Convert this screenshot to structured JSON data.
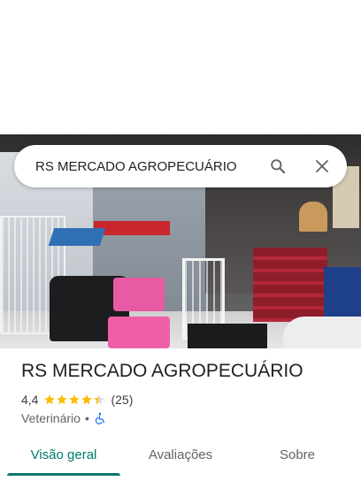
{
  "search": {
    "query": "RS MERCADO AGROPECUÁRIO",
    "search_icon": "search-icon",
    "close_icon": "close-icon"
  },
  "photo": {
    "description_icon": "store-photo"
  },
  "place": {
    "title": "RS MERCADO AGROPECUÁRIO",
    "rating": "4,4",
    "stars": 4.4,
    "review_count": "(25)",
    "category": "Veterinário",
    "separator": "•",
    "accessibility_icon": "wheelchair-icon"
  },
  "tabs": [
    {
      "label": "Visão geral",
      "active": true
    },
    {
      "label": "Avaliações",
      "active": false
    },
    {
      "label": "Sobre",
      "active": false
    }
  ],
  "colors": {
    "accent": "#00796b",
    "star": "#fbbc04",
    "accessibility": "#1a73e8"
  }
}
